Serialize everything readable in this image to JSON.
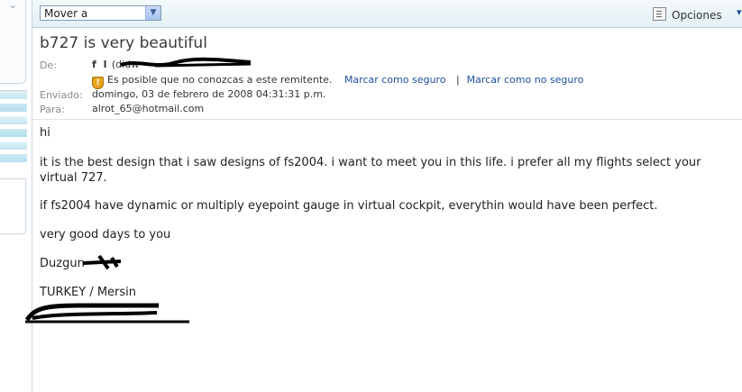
{
  "toolbar": {
    "move_label": "Mover a",
    "options_label": "Opciones"
  },
  "message": {
    "subject": "b727 is very beautiful",
    "from_label": "De:",
    "from_name": "f l",
    "from_email_partial": "(didw",
    "warning_text": "Es posible que no conozcas a este remitente.",
    "mark_safe": "Marcar como seguro",
    "mark_unsafe": "Marcar como no seguro",
    "separator": "|",
    "sent_label": "Enviado:",
    "sent_value": "domingo, 03 de febrero de 2008 04:31:31 p.m.",
    "to_label": "Para:",
    "to_value": "alrot_65@hotmail.com"
  },
  "body": {
    "greeting": "hi",
    "p1_line1": "it is the best design that i saw designs of fs2004. i want to meet you in this life. i prefer all my flights select your",
    "p1_line2": "virtual 727.",
    "p2": "if fs2004 have dynamic or multiply eyepoint gauge in virtual cockpit, everythin would have been perfect.",
    "p3": "very good days to you",
    "signature_name": "Duzgun",
    "signature_location": "TURKEY / Mersin"
  }
}
